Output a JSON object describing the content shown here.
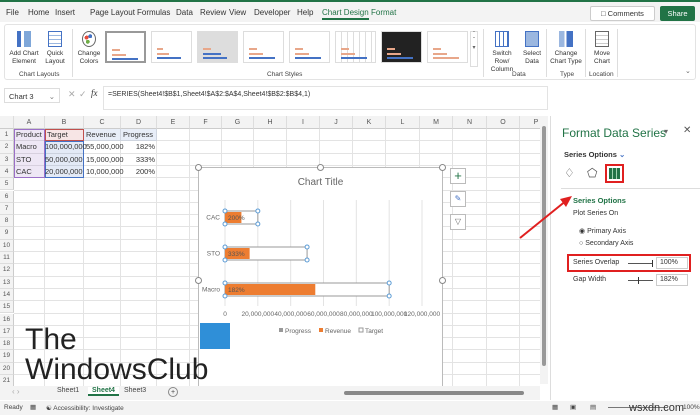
{
  "menu": [
    "File",
    "Home",
    "Insert",
    "Page Layout",
    "Formulas",
    "Data",
    "Review",
    "View",
    "Developer",
    "Help",
    "Chart Design",
    "Format"
  ],
  "comments": "Comments",
  "share": "Share",
  "ribbon": {
    "add_chart_element": "Add Chart Element",
    "quick_layout": "Quick Layout",
    "chart_layouts": "Chart Layouts",
    "change_colors": "Change Colors",
    "chart_styles": "Chart Styles",
    "switch_row_column": "Switch Row/ Column",
    "select_data": "Select Data",
    "data": "Data",
    "change_chart_type": "Change Chart Type",
    "type": "Type",
    "move_chart": "Move Chart",
    "location": "Location"
  },
  "name_box": "Chart 3",
  "formula": "=SERIES(Sheet4!$B$1,Sheet4!$A$2:$A$4,Sheet4!$B$2:$B$4,1)",
  "columns": [
    "A",
    "B",
    "C",
    "D",
    "E",
    "F",
    "G",
    "H",
    "I",
    "J",
    "K",
    "L",
    "M",
    "N",
    "O",
    "P"
  ],
  "rows": [
    "1",
    "2",
    "3",
    "4",
    "5",
    "6",
    "7",
    "8",
    "9",
    "10",
    "11",
    "12",
    "13",
    "14",
    "15",
    "16",
    "17",
    "18",
    "19",
    "20",
    "21"
  ],
  "table": {
    "header": [
      "Product",
      "Target",
      "Revenue",
      "Progress"
    ],
    "data": [
      [
        "Macro",
        "100,000,000",
        "55,000,000",
        "182%"
      ],
      [
        "STO",
        "50,000,000",
        "15,000,000",
        "333%"
      ],
      [
        "CAC",
        "20,000,000",
        "10,000,000",
        "200%"
      ]
    ]
  },
  "chart_data": {
    "type": "bar",
    "title": "Chart Title",
    "categories": [
      "CAC",
      "STO",
      "Macro"
    ],
    "series": [
      {
        "name": "Target",
        "values": [
          20000000,
          50000000,
          100000000
        ],
        "color": "#ffffff"
      },
      {
        "name": "Revenue",
        "values": [
          10000000,
          15000000,
          55000000
        ],
        "color": "#ed7d31"
      }
    ],
    "data_labels": [
      "200%",
      "333%",
      "182%"
    ],
    "xticks": [
      "0",
      "20,000,000",
      "40,000,000",
      "60,000,000",
      "80,000,000",
      "100,000,000",
      "120,000,000"
    ],
    "xlim": [
      0,
      120000000
    ],
    "legend": [
      "Progress",
      "Revenue",
      "Target"
    ],
    "legend_position": "bottom"
  },
  "panel": {
    "title": "Format Data Series",
    "series_options_dropdown": "Series Options",
    "section": "Series Options",
    "plot_series_on": "Plot Series On",
    "primary_axis": "Primary Axis",
    "secondary_axis": "Secondary Axis",
    "series_overlap_label": "Series Overlap",
    "series_overlap": "100%",
    "gap_width_label": "Gap Width",
    "gap_width": "182%"
  },
  "sheets": [
    "Sheet1",
    "Sheet4",
    "Sheet3"
  ],
  "status": {
    "ready": "Ready",
    "accessibility": "Accessibility: Investigate",
    "zoom": "100%"
  },
  "watermark": {
    "line1": "The",
    "line2": "WindowsClub"
  },
  "site": "wsxdn.com",
  "colors": {
    "accent": "#217346",
    "revenue": "#ed7d31",
    "callout": "#e02020"
  }
}
